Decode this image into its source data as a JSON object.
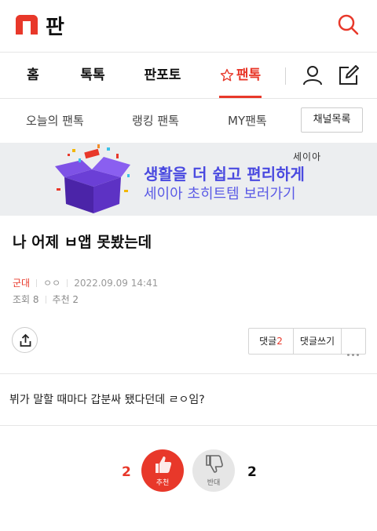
{
  "header": {
    "title": "판"
  },
  "nav": {
    "items": [
      {
        "label": "홈"
      },
      {
        "label": "톡톡"
      },
      {
        "label": "판포토"
      },
      {
        "label": "팬톡"
      }
    ]
  },
  "subnav": {
    "items": [
      {
        "label": "오늘의 팬톡"
      },
      {
        "label": "랭킹 팬톡"
      },
      {
        "label": "MY팬톡"
      }
    ],
    "channel_button": "채널목록"
  },
  "banner": {
    "brand": "세이아",
    "line1": "생활을 더 쉽고 편리하게",
    "line2": "세이아 초히트템 보러가기"
  },
  "post": {
    "title": "나 어제 ㅂ앱 못봤는데",
    "category": "군대",
    "author": "ㅇㅇ",
    "date": "2022.09.09 14:41",
    "views": "조회 8",
    "recommends": "추천 2",
    "body": "뷔가 말할 때마다 갑분싸 됐다던데 ㄹㅇ임?"
  },
  "actions": {
    "comment_label": "댓글",
    "comment_count": "2",
    "write_comment": "댓글쓰기"
  },
  "votes": {
    "up_count": "2",
    "up_label": "추천",
    "down_label": "반대",
    "down_count": "2"
  },
  "colors": {
    "accent": "#e8382a",
    "banner_text": "#4a4ae0"
  }
}
